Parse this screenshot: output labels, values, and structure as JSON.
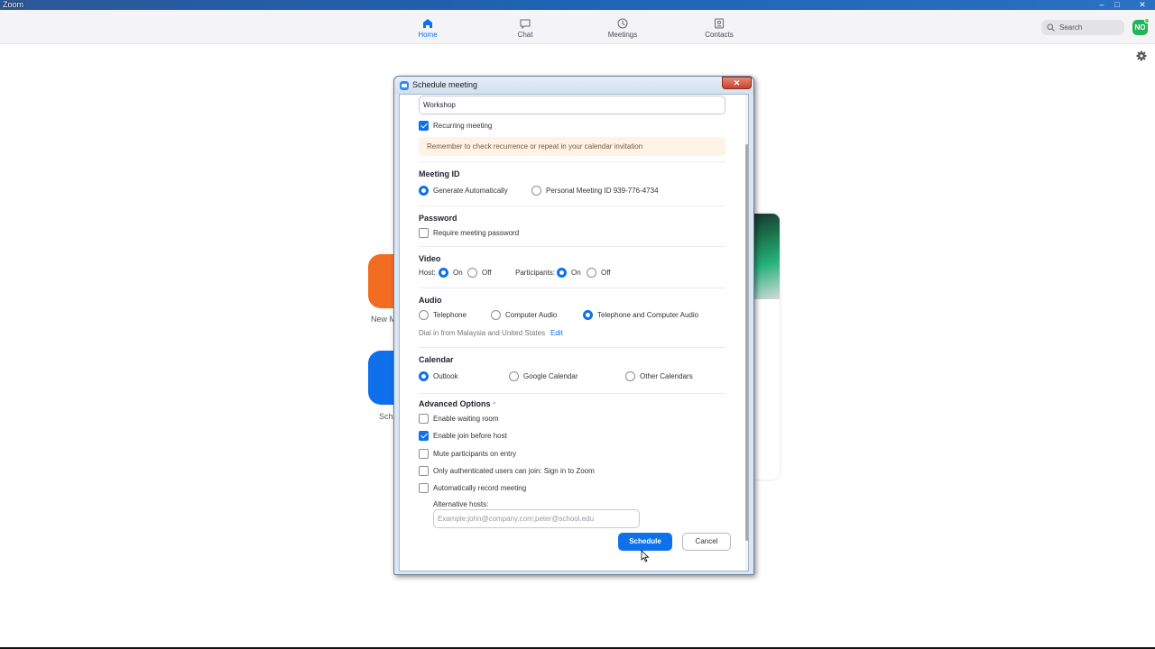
{
  "window": {
    "title": "Zoom",
    "controls": {
      "minimize": "–",
      "maximize": "□",
      "close": "✕"
    }
  },
  "topnav": {
    "tabs": [
      {
        "label": "Home",
        "icon": "home-icon",
        "active": true
      },
      {
        "label": "Chat",
        "icon": "chat-icon",
        "active": false
      },
      {
        "label": "Meetings",
        "icon": "clock-icon",
        "active": false
      },
      {
        "label": "Contacts",
        "icon": "contacts-icon",
        "active": false
      }
    ],
    "search_placeholder": "Search",
    "avatar_initials": "NO",
    "avatar_color": "#23b35e"
  },
  "background": {
    "tiles": [
      {
        "label": "New M",
        "color": "#f26d21"
      },
      {
        "label": "Sche",
        "color": "#0e71eb"
      }
    ]
  },
  "dialog": {
    "title": "Schedule meeting",
    "close_label": "✕",
    "topic_value": "Workshop",
    "recurring": {
      "label": "Recurring meeting",
      "checked": true
    },
    "notice": "Remember to check recurrence or repeat in your calendar invitation",
    "meeting_id": {
      "heading": "Meeting ID",
      "options": [
        {
          "label": "Generate Automatically",
          "selected": true
        },
        {
          "label": "Personal Meeting ID 939-776-4734",
          "selected": false
        }
      ]
    },
    "password": {
      "heading": "Password",
      "option": {
        "label": "Require meeting password",
        "checked": false
      }
    },
    "video": {
      "heading": "Video",
      "host_label": "Host:",
      "participants_label": "Participants:",
      "on_label": "On",
      "off_label": "Off",
      "host": "On",
      "participants": "On"
    },
    "audio": {
      "heading": "Audio",
      "options": [
        {
          "label": "Telephone",
          "selected": false
        },
        {
          "label": "Computer Audio",
          "selected": false
        },
        {
          "label": "Telephone and Computer Audio",
          "selected": true
        }
      ],
      "dial_in_text": "Dial in from Malaysia and United States",
      "edit_label": "Edit"
    },
    "calendar": {
      "heading": "Calendar",
      "options": [
        {
          "label": "Outlook",
          "selected": true
        },
        {
          "label": "Google Calendar",
          "selected": false
        },
        {
          "label": "Other Calendars",
          "selected": false
        }
      ]
    },
    "advanced": {
      "heading": "Advanced Options",
      "toggle": "^",
      "options": [
        {
          "label": "Enable waiting room",
          "checked": false
        },
        {
          "label": "Enable join before host",
          "checked": true
        },
        {
          "label": "Mute participants on entry",
          "checked": false
        },
        {
          "label": "Only authenticated users can join: Sign in to Zoom",
          "checked": false
        },
        {
          "label": "Automatically record meeting",
          "checked": false
        }
      ],
      "alt_hosts_label": "Alternative hosts:",
      "alt_hosts_placeholder": "Example:john@company.com;peter@school.edu"
    },
    "buttons": {
      "schedule": "Schedule",
      "cancel": "Cancel"
    },
    "accent_color": "#0e71eb"
  }
}
